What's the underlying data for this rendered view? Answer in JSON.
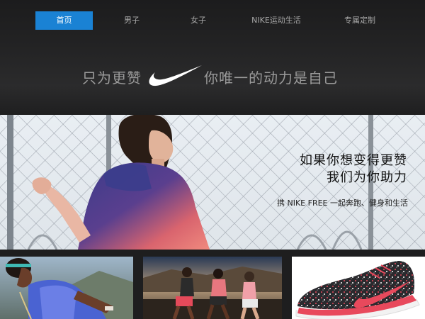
{
  "nav": {
    "items": [
      {
        "label": "首页",
        "active": true
      },
      {
        "label": "男子",
        "active": false
      },
      {
        "label": "女子",
        "active": false
      },
      {
        "label": "NIKE运动生活",
        "active": false
      },
      {
        "label": "专属定制",
        "active": false
      }
    ]
  },
  "slogan": {
    "left": "只为更赞",
    "right": "你唯一的动力是自己",
    "logo_icon": "nike-swoosh-icon"
  },
  "hero": {
    "title_line1": "如果你想变得更赞",
    "title_line2": "我们为你助力",
    "subtitle": "携 NIKE FREE 一起奔跑、健身和生活"
  },
  "thumbnails": [
    {
      "name": "thumb-woman-runner"
    },
    {
      "name": "thumb-group-runners"
    },
    {
      "name": "thumb-nike-free-shoe"
    }
  ],
  "colors": {
    "accent": "#1a82d4",
    "shoe_accent": "#e8495c"
  }
}
